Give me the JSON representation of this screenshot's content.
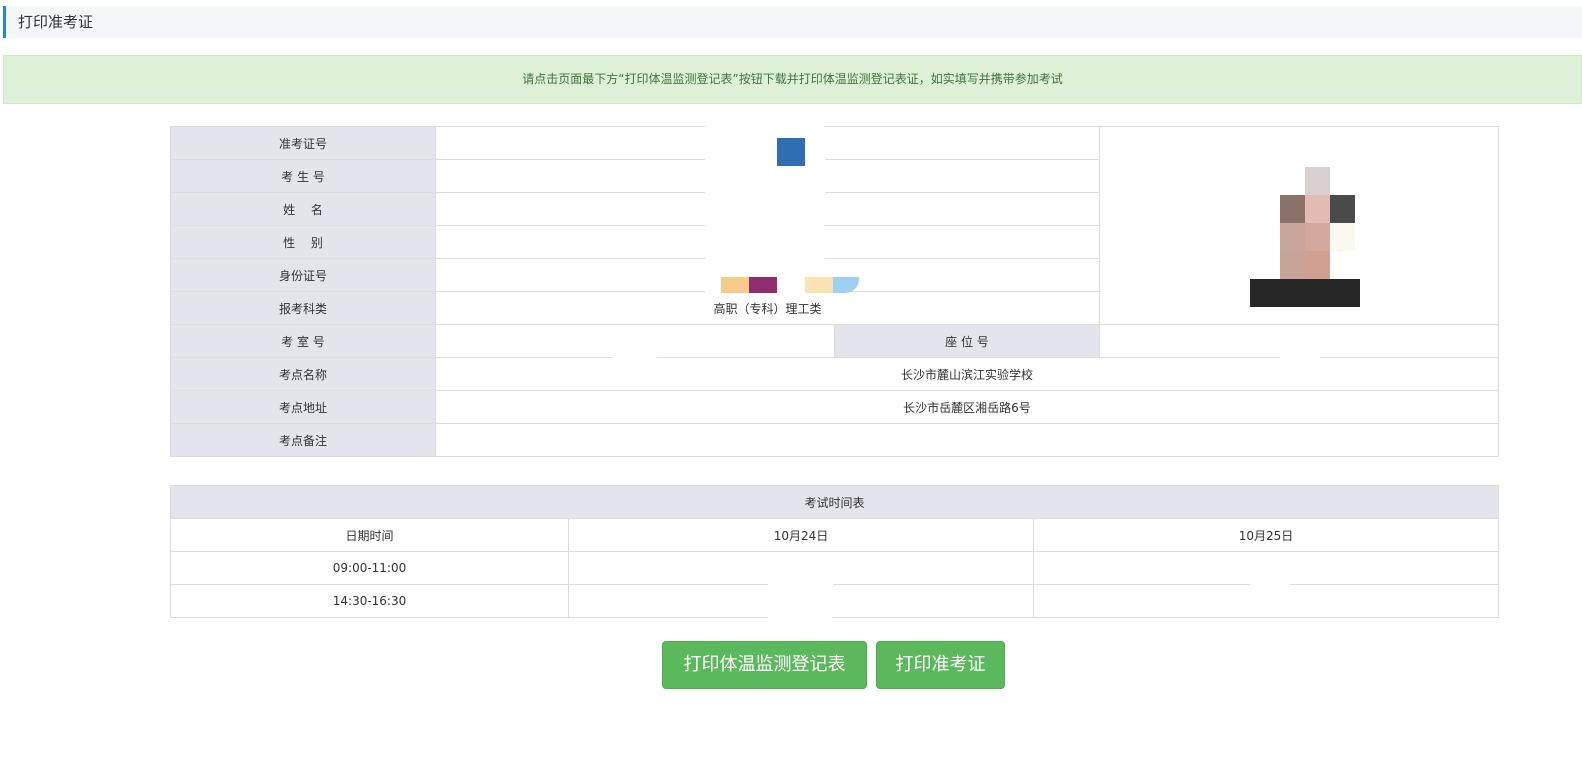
{
  "page": {
    "title": "打印准考证"
  },
  "notice": {
    "text": "请点击页面最下方“打印体温监测登记表”按钮下载并打印体温监测登记表证，如实填写并携带参加考试"
  },
  "info": {
    "labels": {
      "ticket_no": "准考证号",
      "candidate_no": "考 生 号",
      "name": "姓　 名",
      "gender": "性　 别",
      "id_no": "身份证号",
      "category": "报考科类",
      "room": "考 室 号",
      "seat": "座 位 号",
      "site_name": "考点名称",
      "site_address": "考点地址",
      "site_remark": "考点备注"
    },
    "values": {
      "ticket_no": "",
      "candidate_no": "",
      "name": "",
      "gender": "",
      "id_no": "",
      "category": "高职（专科）理工类",
      "room": "",
      "seat": "",
      "site_name": "长沙市麓山滨江实验学校",
      "site_address": "长沙市岳麓区湘岳路6号",
      "site_remark": ""
    }
  },
  "schedule": {
    "title": "考试时间表",
    "header": [
      "日期时间",
      "10月24日",
      "10月25日"
    ],
    "rows": [
      {
        "time": "09:00-11:00",
        "day1": "",
        "day2": ""
      },
      {
        "time": "14:30-16:30",
        "day1": "",
        "day2": ""
      }
    ]
  },
  "buttons": {
    "print_temperature": "打印体温监测登记表",
    "print_ticket": "打印准考证"
  },
  "colors": {
    "accent": "#1a8ccf",
    "notice_bg": "#dff0d8",
    "notice_text": "#3c763d",
    "label_bg": "#e4e4ec",
    "button": "#5cb85c"
  }
}
